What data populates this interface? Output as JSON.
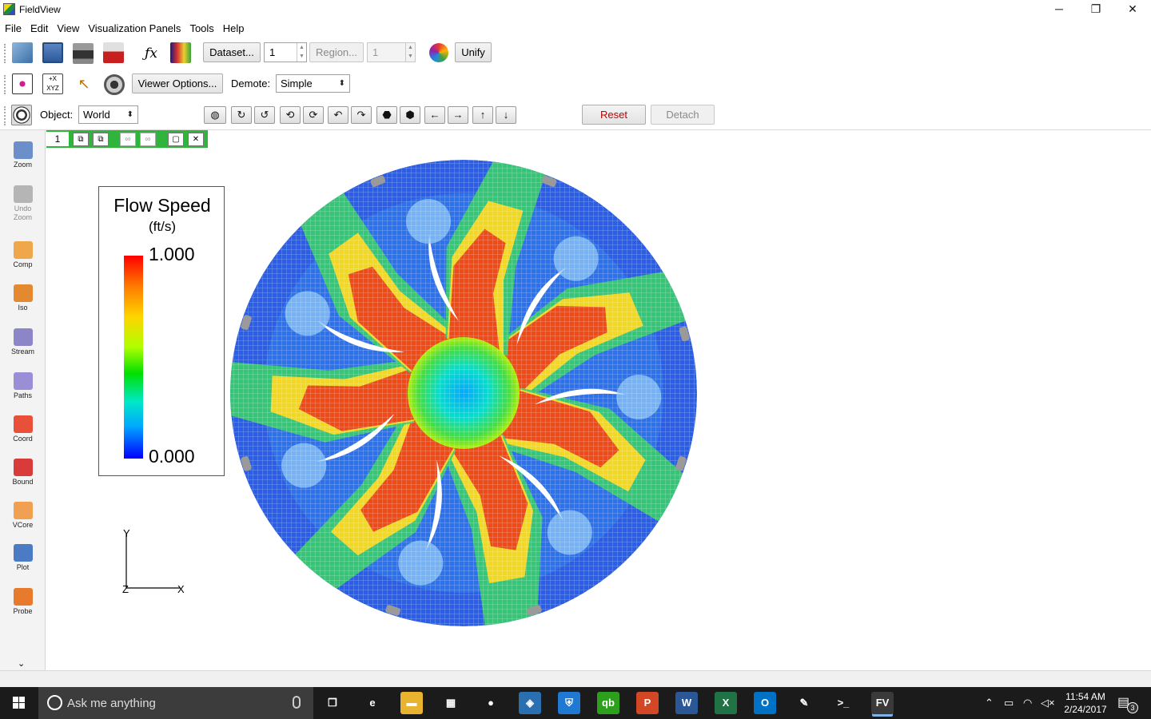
{
  "window": {
    "title": "FieldView",
    "controls": {
      "minimize": "─",
      "restore": "❐",
      "close": "✕"
    }
  },
  "menu": [
    "File",
    "Edit",
    "View",
    "Visualization Panels",
    "Tools",
    "Help"
  ],
  "toolbar1": {
    "dataset_button": "Dataset...",
    "dataset_value": "1",
    "region_button": "Region...",
    "region_value": "1",
    "unify_button": "Unify"
  },
  "toolbar2": {
    "viewer_options_button": "Viewer Options...",
    "demote_label": "Demote:",
    "demote_value": "Simple"
  },
  "toolbar3": {
    "object_label": "Object:",
    "object_value": "World",
    "reset_button": "Reset",
    "detach_button": "Detach"
  },
  "tools": [
    {
      "label": "Zoom",
      "icon": "zoom-icon",
      "enabled": true,
      "color": "#6b8fc9"
    },
    {
      "label": "Undo\nZoom",
      "icon": "undo-zoom-icon",
      "enabled": false,
      "color": "#b5b5b5"
    },
    {
      "label": "Comp",
      "icon": "computational-surface-icon",
      "enabled": true,
      "color": "#f0a64a"
    },
    {
      "label": "Iso",
      "icon": "isosurface-icon",
      "enabled": true,
      "color": "#e3892f"
    },
    {
      "label": "Stream",
      "icon": "streamline-icon",
      "enabled": true,
      "color": "#8c86c9"
    },
    {
      "label": "Paths",
      "icon": "pathlines-icon",
      "enabled": true,
      "color": "#9a8fd6"
    },
    {
      "label": "Coord",
      "icon": "coordinate-surface-icon",
      "enabled": true,
      "color": "#e8503a"
    },
    {
      "label": "Bound",
      "icon": "boundary-surface-icon",
      "enabled": true,
      "color": "#d93b3b"
    },
    {
      "label": "VCore",
      "icon": "vortex-core-icon",
      "enabled": true,
      "color": "#f0a050"
    },
    {
      "label": "Plot",
      "icon": "plot-icon",
      "enabled": true,
      "color": "#4a7bc4"
    },
    {
      "label": "Probe",
      "icon": "probe-icon",
      "enabled": true,
      "color": "#e77a2c"
    }
  ],
  "viewer": {
    "tab_number": "1",
    "legend": {
      "title": "Flow Speed",
      "units": "(ft/s)",
      "max": "1.000",
      "min": "0.000"
    },
    "axes": {
      "y": "Y",
      "z": "Z",
      "x": "X"
    }
  },
  "taskbar": {
    "search_placeholder": "Ask me anything",
    "apps": [
      {
        "name": "task-view-icon",
        "glyph": "❐",
        "color": "#1b1b1b"
      },
      {
        "name": "edge-icon",
        "glyph": "e",
        "color": "#1b1b1b"
      },
      {
        "name": "file-explorer-icon",
        "glyph": "▬",
        "color": "#e8b430"
      },
      {
        "name": "store-icon",
        "glyph": "▦",
        "color": "#1b1b1b"
      },
      {
        "name": "chrome-icon",
        "glyph": "●",
        "color": "#1b1b1b"
      },
      {
        "name": "vpn-icon",
        "glyph": "◈",
        "color": "#2a6fb0"
      },
      {
        "name": "defender-icon",
        "glyph": "⛨",
        "color": "#1f78d1"
      },
      {
        "name": "quickbooks-icon",
        "glyph": "qb",
        "color": "#2ca01c"
      },
      {
        "name": "powerpoint-icon",
        "glyph": "P",
        "color": "#d24726"
      },
      {
        "name": "word-icon",
        "glyph": "W",
        "color": "#2b5797"
      },
      {
        "name": "excel-icon",
        "glyph": "X",
        "color": "#217346"
      },
      {
        "name": "outlook-icon",
        "glyph": "O",
        "color": "#0072c6"
      },
      {
        "name": "pen-tool-icon",
        "glyph": "✎",
        "color": "#1b1b1b"
      },
      {
        "name": "terminal-icon",
        "glyph": ">_",
        "color": "#1b1b1b"
      },
      {
        "name": "fieldview-icon",
        "glyph": "FV",
        "color": "#3a3a3a"
      }
    ],
    "time": "11:54 AM",
    "date": "2/24/2017",
    "notification_count": "3"
  }
}
